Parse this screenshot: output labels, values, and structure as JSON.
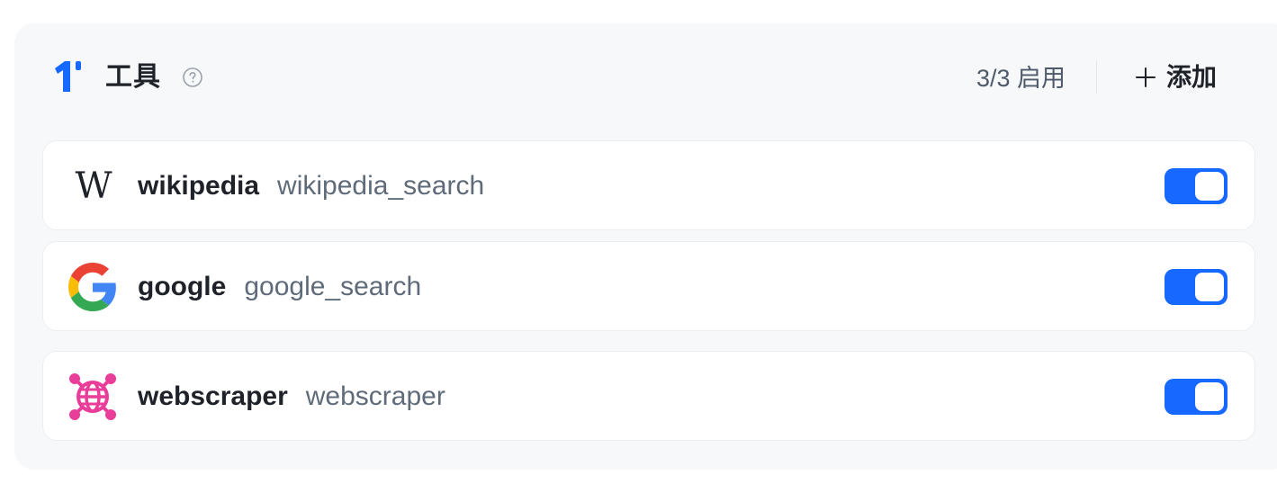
{
  "header": {
    "title": "工具",
    "enabled_count": "3/3 启用",
    "add_label": "添加"
  },
  "colors": {
    "accent": "#1668ff",
    "panel_bg": "#f7f8fa",
    "card_bg": "#ffffff",
    "text_primary": "#1f2329",
    "text_secondary": "#5f6b7a",
    "webscraper_pink": "#e83e9a"
  },
  "tools": [
    {
      "name": "wikipedia",
      "id": "wikipedia_search",
      "icon": "wikipedia-icon",
      "icon_glyph": "W",
      "enabled": true
    },
    {
      "name": "google",
      "id": "google_search",
      "icon": "google-icon",
      "enabled": true
    },
    {
      "name": "webscraper",
      "id": "webscraper",
      "icon": "webscraper-globe-icon",
      "enabled": true
    }
  ]
}
